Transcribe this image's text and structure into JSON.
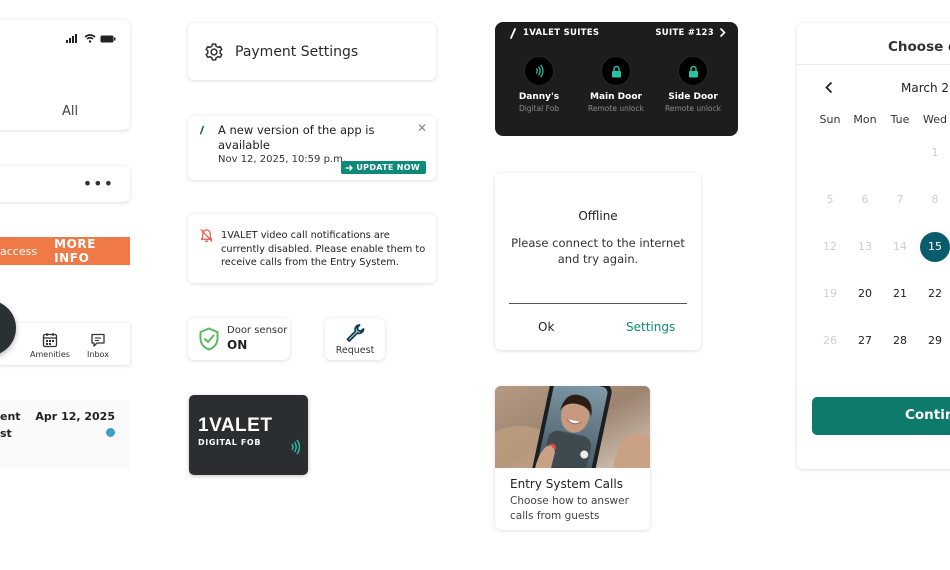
{
  "col1": {
    "tab_label": "All",
    "banner_text": "access",
    "banner_button": "MORE INFO",
    "nav": {
      "amenities": "Amenities",
      "inbox": "Inbox"
    },
    "list": {
      "line1": "ent",
      "line2": "st",
      "date": "Apr 12, 2025"
    }
  },
  "payment": {
    "label": "Payment Settings"
  },
  "update_card": {
    "title": "A new version of the app is available",
    "date": "Nov 12, 2025, 10:59 p.m.",
    "button": "UPDATE NOW"
  },
  "notification_card": {
    "text": "1VALET video call notifications are currently disabled. Please enable them to receive calls from the Entry System."
  },
  "door_sensor": {
    "label": "Door sensor",
    "value": "ON"
  },
  "request": {
    "label": "Request"
  },
  "fob_card": {
    "logo": "1VALET",
    "subtitle": "DIGITAL FOB"
  },
  "suites": {
    "name": "1VALET SUITES",
    "number": "SUITE #123",
    "locks": [
      {
        "name": "Danny's",
        "sub": "Digital Fob"
      },
      {
        "name": "Main Door",
        "sub": "Remote unlock"
      },
      {
        "name": "Side Door",
        "sub": "Remote unlock"
      }
    ]
  },
  "offline_dialog": {
    "title": "Offline",
    "message": "Please connect to the internet and try again.",
    "ok": "Ok",
    "settings": "Settings"
  },
  "entry_calls": {
    "title": "Entry System Calls",
    "subtitle": "Choose how to answer calls from guests"
  },
  "calendar": {
    "title": "Choose d",
    "month": "March 2",
    "weekdays": [
      "Sun",
      "Mon",
      "Tue",
      "Wed"
    ],
    "rows": [
      [
        "",
        "",
        "",
        "1"
      ],
      [
        "5",
        "6",
        "7",
        "8"
      ],
      [
        "12",
        "13",
        "14",
        "15"
      ],
      [
        "19",
        "20",
        "21",
        "22"
      ],
      [
        "26",
        "27",
        "28",
        "29"
      ]
    ],
    "selected_day": "15",
    "button": "Contin"
  },
  "colors": {
    "accent": "#0e8a78",
    "alert": "#ef7a47",
    "selected": "#0a5c6c",
    "dark": "#1d1d1d"
  }
}
